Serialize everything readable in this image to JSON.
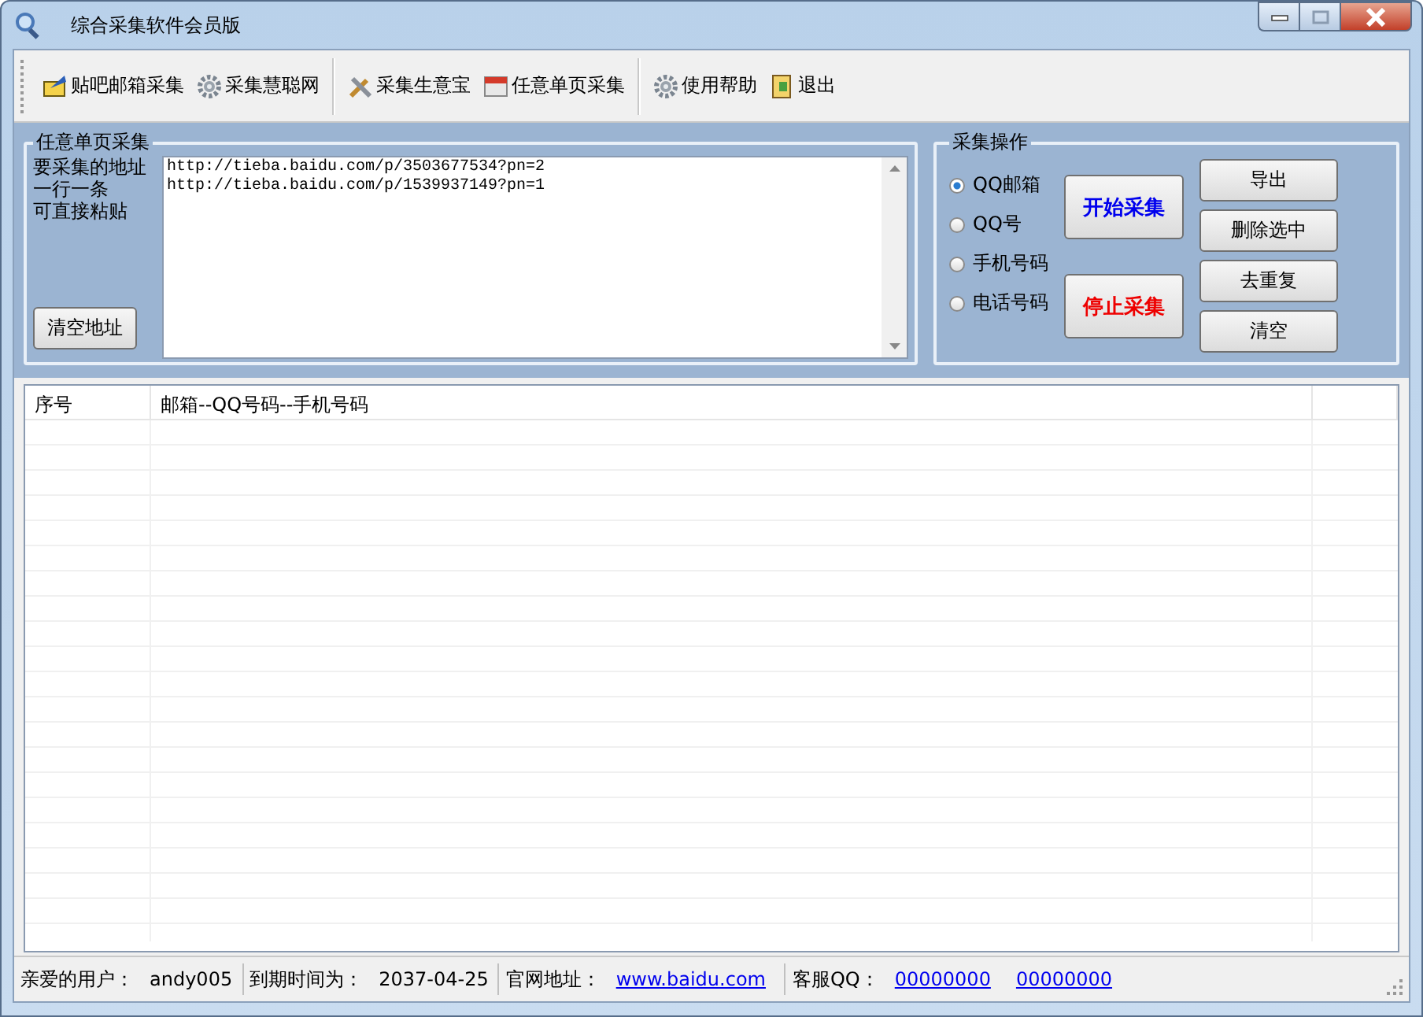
{
  "window": {
    "title": "综合采集软件会员版"
  },
  "toolbar": {
    "groups": [
      [
        {
          "label": "贴吧邮箱采集"
        },
        {
          "label": "采集慧聪网"
        }
      ],
      [
        {
          "label": "采集生意宝"
        },
        {
          "label": "任意单页采集"
        }
      ],
      [
        {
          "label": "使用帮助"
        },
        {
          "label": "退出"
        }
      ]
    ]
  },
  "url_panel": {
    "title": "任意单页采集",
    "hint": [
      "要采集的地址",
      "一行一条",
      "可直接粘贴"
    ],
    "urls": "http://tieba.baidu.com/p/3503677534?pn=2\nhttp://tieba.baidu.com/p/1539937149?pn=1",
    "clear_button": "清空地址"
  },
  "operations": {
    "title": "采集操作",
    "options": [
      {
        "label": "QQ邮箱",
        "selected": true
      },
      {
        "label": "QQ号",
        "selected": false
      },
      {
        "label": "手机号码",
        "selected": false
      },
      {
        "label": "电话号码",
        "selected": false
      }
    ],
    "actions": [
      {
        "kind": "start",
        "label": "开始采集"
      },
      {
        "kind": "stop",
        "label": "停止采集"
      }
    ],
    "buttons": [
      "导出",
      "删除选中",
      "去重复",
      "清空"
    ]
  },
  "table": {
    "columns": [
      "序号",
      "邮箱--QQ号码--手机号码"
    ]
  },
  "status_bar": [
    {
      "label": "亲爱的用户：",
      "values": [
        {
          "text": "andy005",
          "link": false
        }
      ]
    },
    {
      "label": "到期时间为：",
      "values": [
        {
          "text": "2037-04-25",
          "link": false
        }
      ]
    },
    {
      "label": "官网地址：",
      "values": [
        {
          "text": "www.baidu.com",
          "link": true
        }
      ]
    },
    {
      "label": "客服QQ：",
      "values": [
        {
          "text": "00000000",
          "link": true
        },
        {
          "text": "00000000",
          "link": true
        }
      ]
    }
  ]
}
